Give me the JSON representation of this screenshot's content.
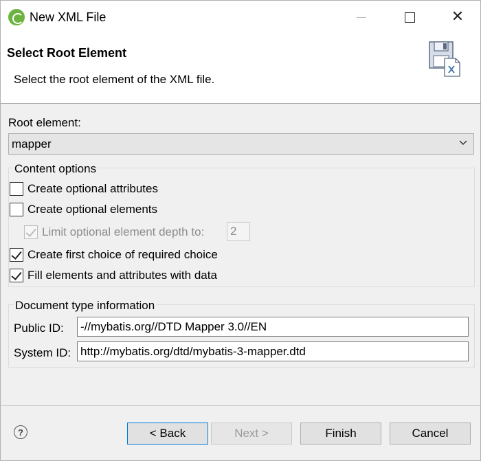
{
  "window": {
    "title": "New XML File",
    "close_glyph": "✕"
  },
  "banner": {
    "title": "Select Root Element",
    "description": "Select the root element of the XML file."
  },
  "root": {
    "label": "Root element:",
    "value": "mapper"
  },
  "content_options": {
    "legend": "Content options",
    "create_optional_attributes": {
      "label": "Create optional attributes",
      "checked": false
    },
    "create_optional_elements": {
      "label": "Create optional elements",
      "checked": false
    },
    "limit_depth": {
      "label": "Limit optional element depth to:",
      "checked": true,
      "enabled": false,
      "value": "2"
    },
    "create_first_choice": {
      "label": "Create first choice of required choice",
      "checked": true
    },
    "fill_elements": {
      "label": "Fill elements and attributes with data",
      "checked": true
    }
  },
  "doctype": {
    "legend": "Document type information",
    "public_id_label": "Public ID:",
    "public_id_value": "-//mybatis.org//DTD Mapper 3.0//EN",
    "system_id_label": "System ID:",
    "system_id_value": "http://mybatis.org/dtd/mybatis-3-mapper.dtd"
  },
  "buttons": {
    "help": "?",
    "back": "< Back",
    "next": "Next >",
    "finish": "Finish",
    "cancel": "Cancel"
  }
}
